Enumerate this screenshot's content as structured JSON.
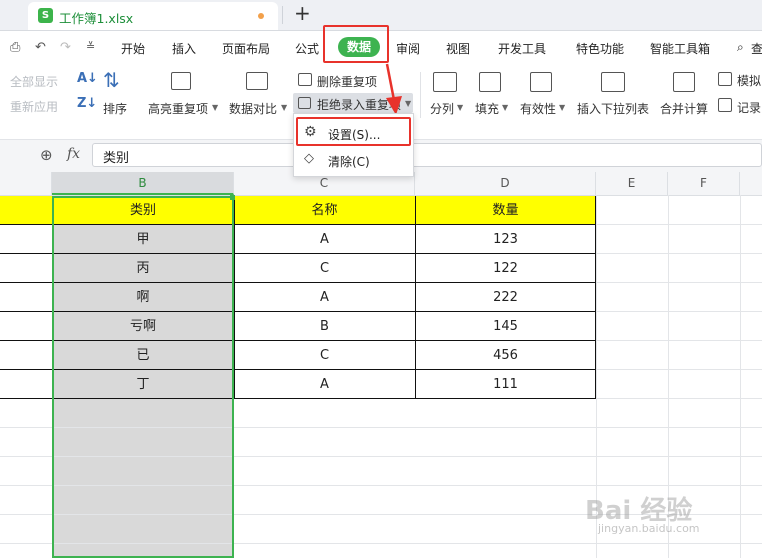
{
  "tabbar": {
    "app_icon": "S",
    "doc_title": "工作簿1.xlsx",
    "new_tab": "+"
  },
  "menubar": {
    "items": [
      "开始",
      "插入",
      "页面布局",
      "公式",
      "数据",
      "审阅",
      "视图",
      "开发工具",
      "特色功能",
      "智能工具箱"
    ],
    "search_label": "查"
  },
  "ribbon": {
    "show_all": "全部显示",
    "reapply": "重新应用",
    "sort": "排序",
    "highlight_dup": "高亮重复项",
    "data_compare": "数据对比",
    "remove_dup": "删除重复项",
    "reject_dup": "拒绝录入重复项",
    "split_column": "分列",
    "fill": "填充",
    "validity": "有效性",
    "insert_dropdown": "插入下拉列表",
    "consolidate": "合并计算",
    "simulate": "模拟",
    "record": "记录"
  },
  "dropdown": {
    "settings": "设置(S)...",
    "clear": "清除(C)"
  },
  "formula_bar": {
    "fx": "fx",
    "content": "类别"
  },
  "grid": {
    "columns": [
      "B",
      "C",
      "D",
      "E",
      "F"
    ],
    "header": [
      "类别",
      "名称",
      "数量"
    ],
    "rows": [
      [
        "甲",
        "A",
        "123"
      ],
      [
        "丙",
        "C",
        "122"
      ],
      [
        "啊",
        "A",
        "222"
      ],
      [
        "亏啊",
        "B",
        "145"
      ],
      [
        "已",
        "C",
        "456"
      ],
      [
        "丁",
        "A",
        "111"
      ]
    ]
  },
  "watermark": {
    "brand": "Bai 经验",
    "url": "jingyan.baidu.com"
  },
  "colors": {
    "accent_green": "#3db350",
    "highlight_red": "#e8322b",
    "header_yellow": "#ffff00",
    "selected_col_gray": "#d9d9d9"
  }
}
